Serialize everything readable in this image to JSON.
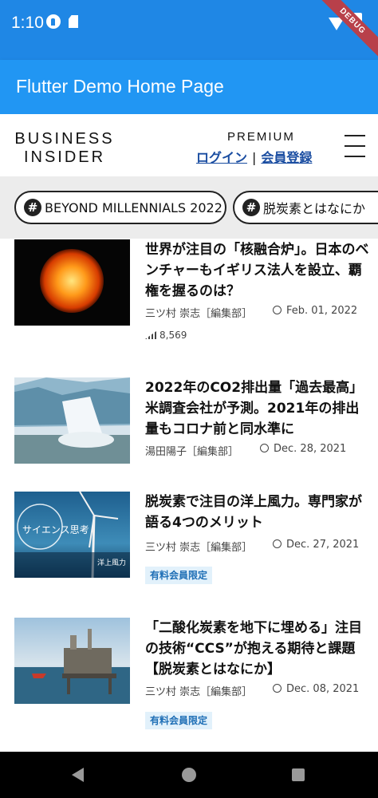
{
  "status": {
    "time": "1:10",
    "debug": "DEBUG"
  },
  "appbar": {
    "title": "Flutter Demo Home Page"
  },
  "header": {
    "logo_line1": "BUSINESS",
    "logo_line2": "INSIDER",
    "premium": "PREMIUM",
    "login": "ログイン",
    "separator": "|",
    "register": "会員登録"
  },
  "tags": [
    {
      "label": "BEYOND MILLENNIALS 2022"
    },
    {
      "label": "脱炭素とはなにか"
    }
  ],
  "articles": [
    {
      "title": "世界が注目の「核融合炉」。日本のベンチャーもイギリス法人を設立、覇権を握るのは？",
      "author": "三ツ村 崇志［編集部］",
      "date": "Feb. 01, 2022",
      "views": "8,569"
    },
    {
      "title": "2022年のCO2排出量「過去最高」米調査会社が予測。2021年の排出量もコロナ前と同水準に",
      "author": "湯田陽子［編集部］",
      "date": "Dec. 28, 2021"
    },
    {
      "title": "脱炭素で注目の洋上風力。専門家が語る4つのメリット",
      "author": "三ツ村 崇志［編集部］",
      "date": "Dec. 27, 2021",
      "badge": "有料会員限定",
      "thumb_text": "サイエンス思考",
      "thumb_caption": "洋上風力"
    },
    {
      "title": "「二酸化炭素を地下に埋める」注目の技術“CCS”が抱える期待と課題【脱炭素とはなにか】",
      "author": "三ツ村 崇志［編集部］",
      "date": "Dec. 08, 2021",
      "badge": "有料会員限定"
    }
  ],
  "icons": [
    "notification-icon",
    "sd-card-icon",
    "wifi-icon",
    "battery-icon",
    "menu-icon",
    "hashtag-icon",
    "clock-icon",
    "views-icon",
    "back-icon",
    "home-icon",
    "recents-icon"
  ]
}
